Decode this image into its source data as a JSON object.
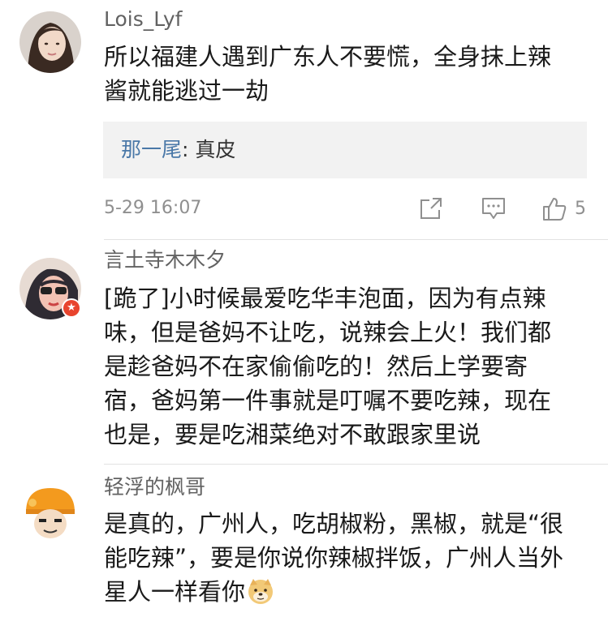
{
  "comments": [
    {
      "username": "Lois_Lyf",
      "body_lines": [
        "所以福建人遇到广东人不要慌，全身抹上辣",
        "酱就能逃过一劫"
      ],
      "reply": {
        "name": "那一尾",
        "separator": ": ",
        "content": "真皮"
      },
      "timestamp": "5-29 16:07",
      "like_count": "5"
    },
    {
      "username": "言土寺木木夕",
      "body_lines": [
        "[跪了]小时候最爱吃华丰泡面，因为有点辣",
        "味，但是爸妈不让吃，说辣会上火！我们都",
        "是趁爸妈不在家偷偷吃的！然后上学要寄",
        "宿，爸妈第一件事就是叮嘱不要吃辣，现在",
        "也是，要是吃湘菜绝对不敢跟家里说"
      ],
      "badge_icon": "star-badge-icon"
    },
    {
      "username": "轻浮的枫哥",
      "body_lines": [
        "是真的，广州人，吃胡椒粉，黑椒，就是“很",
        "能吃辣”，要是你说你辣椒拌饭，广州人当外",
        "星人一样看你"
      ],
      "trailing_emoji": "doge-emoji-icon"
    }
  ],
  "icons": {
    "share": "share-icon",
    "comment": "comment-icon",
    "like": "thumbs-up-icon"
  },
  "colors": {
    "reply_name": "#4a78a8",
    "meta_text": "#8f8f8f",
    "badge": "#e8442e"
  }
}
